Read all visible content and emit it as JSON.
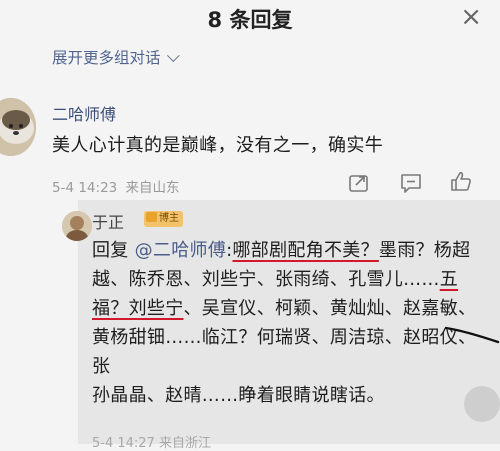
{
  "header": {
    "title": "8 条回复",
    "close_glyph": "×",
    "expand_label": "展开更多组对话"
  },
  "comment": {
    "username": "二哈师傅",
    "text": "美人心计真的是巅峰，没有之一，确实牛",
    "timestamp": "5-4 14:23",
    "location": "来自山东",
    "icons": [
      "share-icon",
      "comment-icon",
      "like-icon"
    ]
  },
  "reply": {
    "username": "于正",
    "badge": "博主",
    "prefix": "回复 ",
    "mention": "@二哈师傅",
    "colon": ":",
    "seg1": "哪部剧配角不美？",
    "seg2": "墨雨？杨超越、陈乔恩、刘些宁、张雨绮、孔雪儿……",
    "seg3": "五福？刘些宁",
    "seg4": "、吴宣仪、柯颖、黄灿灿、赵嘉敏、黄杨甜钿……临江？何瑞贤、周洁琼、赵昭仪、张",
    "seg5": "孙晶晶、赵晴……睁着眼睛说瞎话。",
    "meta": "5-4 14:27 来自浙江"
  },
  "colors": {
    "link": "#3c4f7a",
    "underline": "#d11b2c",
    "reply_bg": "#e6e6e6",
    "page_bg": "#f4f4f4"
  }
}
